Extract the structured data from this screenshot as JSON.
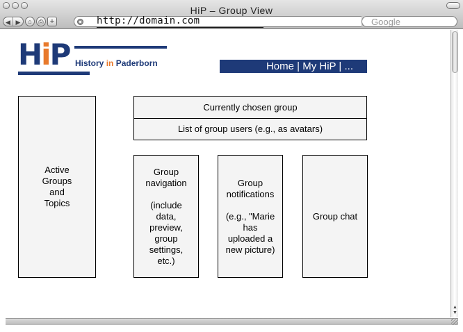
{
  "window": {
    "title": "HiP – Group View",
    "url": "http://domain.com",
    "search_placeholder": "Google"
  },
  "toolbar": {
    "back_icon": "◀",
    "forward_icon": "▶",
    "home_icon": "⌂",
    "print_icon": "⎙",
    "add_icon": "+",
    "scroll_up_icon": "▲",
    "scroll_down_icon": "▼"
  },
  "logo": {
    "letters_h": "H",
    "letters_i": "i",
    "letters_p": "P",
    "subtitle_history": "History",
    "subtitle_in": "in",
    "subtitle_place": "Paderborn",
    "brand_color": "#1e3a78",
    "accent_color": "#e8792b"
  },
  "nav": {
    "label": "Home | My HiP | ..."
  },
  "panels": {
    "active_groups": "Active\nGroups\nand\nTopics",
    "current_group": "Currently chosen group",
    "group_users": "List of group users (e.g., as avatars)",
    "group_navigation": "Group\nnavigation\n\n(include\ndata,\npreview,\ngroup\nsettings,\netc.)",
    "group_notifications": "Group\nnotifications\n\n(e.g., \"Marie\nhas\nuploaded a\nnew picture)",
    "group_chat": "Group chat"
  }
}
